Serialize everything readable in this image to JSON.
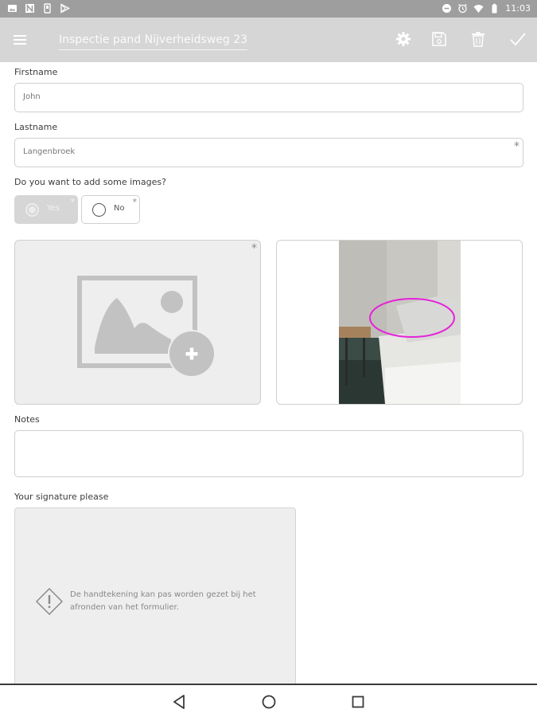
{
  "status_bar": {
    "time": "11:03",
    "left_icons": [
      "image-icon",
      "n-icon",
      "sim-icon",
      "play-store-icon"
    ],
    "right_icons": [
      "minus-circle-icon",
      "alarm-icon",
      "wifi-icon",
      "battery-icon"
    ],
    "color": "#9e9e9e"
  },
  "toolbar": {
    "title": "Inspectie pand Nijverheidsweg 23",
    "actions": [
      "settings-icon",
      "save-icon",
      "delete-icon",
      "check-icon"
    ],
    "color": "#d6d6d6"
  },
  "form": {
    "firstname": {
      "label": "Firstname",
      "value": "John"
    },
    "lastname": {
      "label": "Lastname",
      "value": "Langenbroek",
      "required": "*"
    },
    "images_question": {
      "label": "Do you want to add some images?",
      "options": [
        {
          "label": "Yes",
          "selected": true,
          "required": "*"
        },
        {
          "label": "No",
          "selected": false,
          "required": "*"
        }
      ]
    },
    "image_upload": {
      "required": "*",
      "icon": "add-image-icon"
    },
    "photo": {
      "icon": "photo-thumbnail"
    },
    "notes": {
      "label": "Notes",
      "value": ""
    },
    "signature": {
      "label": "Your signature please",
      "message": "De handtekening kan pas worden gezet bij het afronden van het formulier.",
      "icon": "warning-icon"
    }
  },
  "nav_bar": {
    "buttons": [
      "back-icon",
      "home-icon",
      "recents-icon"
    ]
  }
}
